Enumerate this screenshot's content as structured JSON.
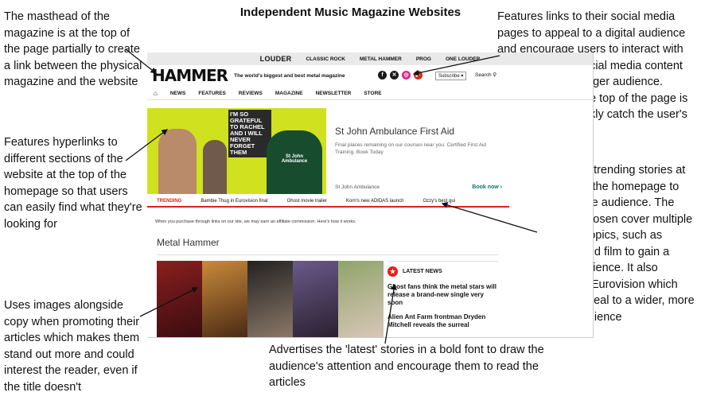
{
  "title": "Independent Music Magazine Websites",
  "annotations": {
    "masthead": "The masthead of the magazine is at the top of the page partially to create a link between the physical magazine and the website",
    "social": "Features links to their social media pages to appeal to a digital audience and encourage users to interact with and share their social media content to spread it to a larger audience. Placing them at the top of the page is more likely to quickly catch the user's attention",
    "hyperlinks": "Features hyperlinks to different sections of the website at the top of the homepage so that users can easily find what they're looking for",
    "trending": "Promotes trending stories at the top of the homepage to interest the audience. The articles chosen cover multiple different topics, such as fashion and film to gain a larger audience. It also mentions Eurovision which would appeal to a wider, more global audience",
    "images": "Uses images alongside copy when promoting their articles which makes them stand out more and could interest the reader, even if the title doesn't",
    "latest": "Advertises the 'latest' stories in a bold font to draw the audience's attention and encourage them to read the articles"
  },
  "site": {
    "topstrip": [
      "LOUDER",
      "CLASSIC ROCK",
      "METAL HAMMER",
      "PROG",
      "ONE LOUDER"
    ],
    "logo": "HAMMER",
    "tagline": "The world's biggest and best metal magazine",
    "social_icons": [
      "facebook-icon",
      "x-icon",
      "instagram-icon",
      "youtube-icon"
    ],
    "subscribe": "Subscribe ▾",
    "search": "Search",
    "nav": [
      "NEWS",
      "FEATURES",
      "REVIEWS",
      "MAGAZINE",
      "NEWSLETTER",
      "STORE"
    ],
    "ad": {
      "image_text": "I'M SO GRATEFUL TO RACHEL AND I WILL NEVER FORGET THEM",
      "jacket_text": "St John Ambulance",
      "headline": "St John Ambulance First Aid",
      "body": "Final places remaining on our courses near you. Certified First Aid Training. Book Today",
      "advertiser": "St John Ambulance",
      "cta": "Book now ›"
    },
    "trending_label": "TRENDING",
    "trending": [
      "Bambie Thug in Eurovision final",
      "Ghost movie trailer",
      "Korn's new ADIDAS launch",
      "Ozzy's best gui"
    ],
    "affiliate": "When you purchase through links on our site, we may earn an affiliate commission. Here's how it works.",
    "section": "Metal Hammer",
    "latest_label": "LATEST NEWS",
    "latest": [
      "Ghost fans think the metal stars will release a brand-new single very soon",
      "Alien Ant Farm frontman Dryden Mitchell reveals the surreal"
    ],
    "colors": {
      "accent": "#e0211b",
      "cta": "#0b7a6d",
      "ad_bg": "#cfe11f"
    }
  }
}
